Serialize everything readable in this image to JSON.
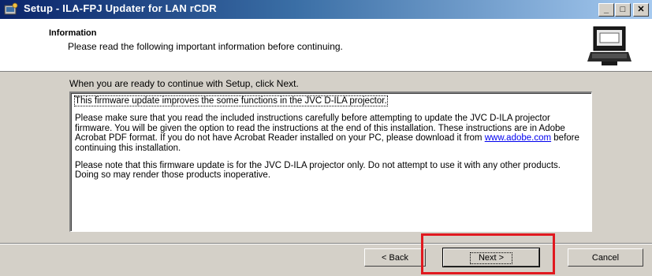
{
  "window": {
    "title": "Setup - ILA-FPJ Updater for LAN rCDR"
  },
  "title_buttons": {
    "minimize": "_",
    "maximize": "□",
    "close": "✕"
  },
  "header": {
    "title": "Information",
    "subtitle": "Please read the following important information before continuing."
  },
  "instruction": "When you are ready to continue with Setup, click Next.",
  "memo": {
    "paragraph1": "This firmware update improves the some functions in the JVC D-ILA projector.",
    "paragraph2_before_link": "Please make sure that you read the included instructions carefully before attempting to update the JVC D-ILA projector firmware. You will be given the option to read the instructions at the end of this installation. These instructions are in Adobe Acrobat PDF format. If you do not have Acrobat Reader installed on your PC, please download it from ",
    "link": "www.adobe.com",
    "paragraph2_after_link": " before continuing this installation.",
    "paragraph3": "Please note that this firmware update is for the JVC D-ILA projector only. Do not attempt to use it with any other products. Doing so may render those products inoperative."
  },
  "buttons": {
    "back": "< Back",
    "next": "Next >",
    "cancel": "Cancel"
  },
  "colors": {
    "highlight": "#e0191f",
    "title_bar_start": "#0a246a",
    "title_bar_end": "#a6caf0"
  }
}
